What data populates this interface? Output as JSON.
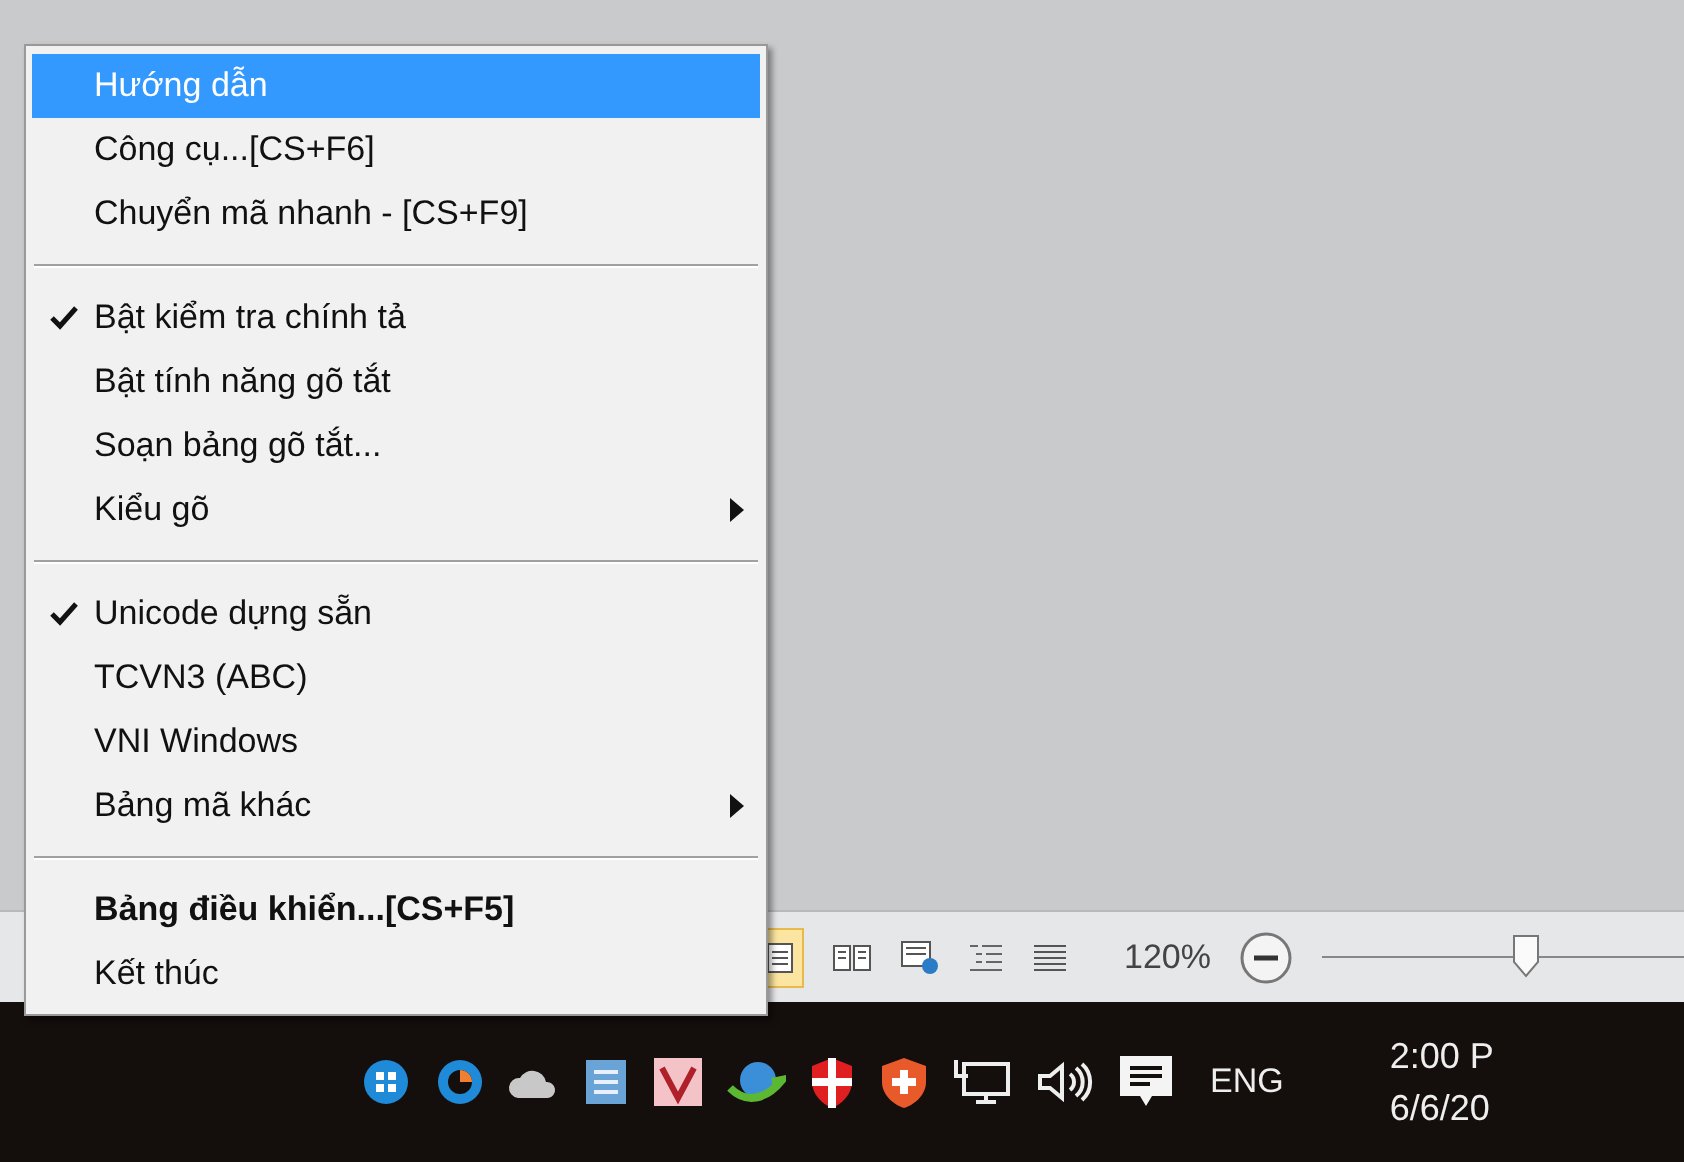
{
  "context_menu": {
    "items": [
      {
        "kind": "item",
        "label": "Hướng dẫn",
        "selected": true,
        "checked": false,
        "bold": false,
        "submenu": false
      },
      {
        "kind": "item",
        "label": "Công cụ...[CS+F6]",
        "selected": false,
        "checked": false,
        "bold": false,
        "submenu": false
      },
      {
        "kind": "item",
        "label": "Chuyển mã nhanh - [CS+F9]",
        "selected": false,
        "checked": false,
        "bold": false,
        "submenu": false
      },
      {
        "kind": "separator"
      },
      {
        "kind": "item",
        "label": "Bật kiểm tra chính tả",
        "selected": false,
        "checked": true,
        "bold": false,
        "submenu": false
      },
      {
        "kind": "item",
        "label": "Bật tính năng gõ tắt",
        "selected": false,
        "checked": false,
        "bold": false,
        "submenu": false
      },
      {
        "kind": "item",
        "label": "Soạn bảng gõ tắt...",
        "selected": false,
        "checked": false,
        "bold": false,
        "submenu": false
      },
      {
        "kind": "item",
        "label": "Kiểu gõ",
        "selected": false,
        "checked": false,
        "bold": false,
        "submenu": true
      },
      {
        "kind": "separator"
      },
      {
        "kind": "item",
        "label": "Unicode dựng sẵn",
        "selected": false,
        "checked": true,
        "bold": false,
        "submenu": false
      },
      {
        "kind": "item",
        "label": "TCVN3 (ABC)",
        "selected": false,
        "checked": false,
        "bold": false,
        "submenu": false
      },
      {
        "kind": "item",
        "label": "VNI Windows",
        "selected": false,
        "checked": false,
        "bold": false,
        "submenu": false
      },
      {
        "kind": "item",
        "label": "Bảng mã khác",
        "selected": false,
        "checked": false,
        "bold": false,
        "submenu": true
      },
      {
        "kind": "separator"
      },
      {
        "kind": "item",
        "label": "Bảng điều khiển...[CS+F5]",
        "selected": false,
        "checked": false,
        "bold": true,
        "submenu": false
      },
      {
        "kind": "item",
        "label": "Kết thúc",
        "selected": false,
        "checked": false,
        "bold": false,
        "submenu": false
      }
    ]
  },
  "status_bar": {
    "zoom": "120%",
    "zoom_slider": {
      "level": 0.56
    }
  },
  "taskbar": {
    "language": "ENG",
    "time": "2:00 P",
    "date": "6/6/20"
  }
}
